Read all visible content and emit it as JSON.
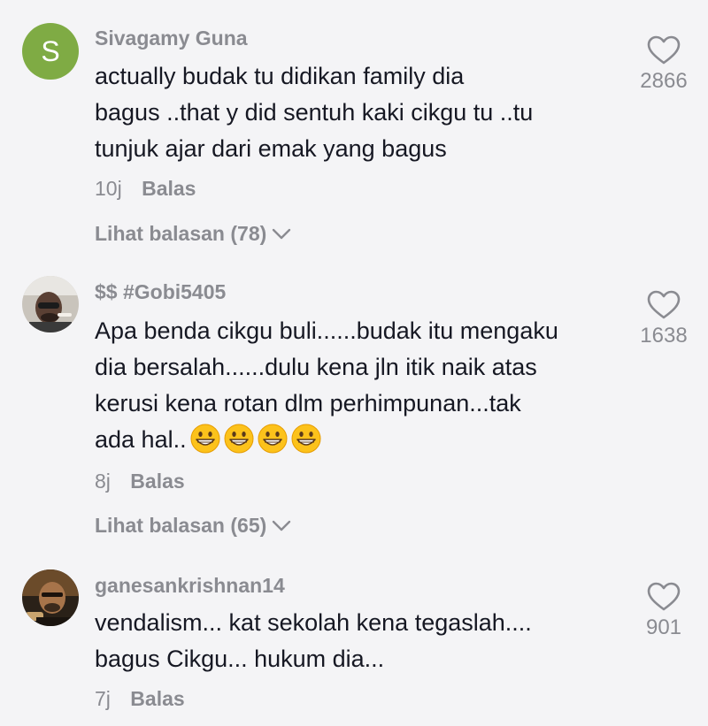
{
  "comments": [
    {
      "avatar_letter": "S",
      "username": "Sivagamy Guna",
      "text_lines": [
        "actually budak tu didikan family dia",
        "bagus ..that y did sentuh kaki cikgu tu ..tu",
        "tunjuk ajar dari emak yang bagus"
      ],
      "time": "10j",
      "reply_label": "Balas",
      "view_replies_label": "Lihat balasan (78)",
      "like_count": "2866"
    },
    {
      "username": "$$ #Gobi5405",
      "text_lines": [
        "Apa benda cikgu buli......budak itu mengaku",
        "dia bersalah......dulu kena jln itik naik atas",
        "kerusi kena rotan dlm perhimpunan...tak",
        "ada hal.."
      ],
      "emoji": [
        "grinning-face-icon",
        "grinning-face-icon",
        "grinning-face-icon",
        "grinning-face-icon"
      ],
      "time": "8j",
      "reply_label": "Balas",
      "view_replies_label": "Lihat balasan (65)",
      "like_count": "1638"
    },
    {
      "username": "ganesankrishnan14",
      "text_lines": [
        "vendalism... kat sekolah kena tegaslah....",
        "bagus Cikgu... hukum dia..."
      ],
      "time": "7j",
      "reply_label": "Balas",
      "like_count": "901"
    }
  ],
  "colors": {
    "background": "#f4f4f6",
    "text": "#161823",
    "secondary": "#8a8b91",
    "avatar_green": "#7fab44"
  }
}
